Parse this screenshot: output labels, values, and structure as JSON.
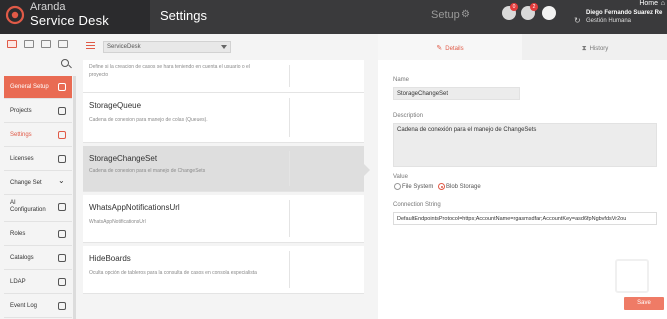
{
  "brand": {
    "line1": "Aranda",
    "line2": "Service Desk"
  },
  "page_title": "Settings",
  "setup_label": "Setup",
  "notifications": {
    "first_count": "0",
    "second_count": "2"
  },
  "home_label": "Home",
  "user": {
    "name": "Diego Fernando Suarez Re",
    "group": "Gestión Humana"
  },
  "nav": [
    {
      "label": "General Setup",
      "icon": "gears-icon"
    },
    {
      "label": "Projects",
      "icon": "gear-icon"
    },
    {
      "label": "Settings",
      "icon": "sliders-icon"
    },
    {
      "label": "Licenses",
      "icon": "shield-icon"
    },
    {
      "label": "Change Set",
      "icon": "chevron-down-icon"
    },
    {
      "label": "AI Configuration",
      "icon": "robot-icon"
    },
    {
      "label": "Roles",
      "icon": "id-card-icon"
    },
    {
      "label": "Catalogs",
      "icon": "catalog-icon"
    },
    {
      "label": "LDAP",
      "icon": "ldap-icon"
    },
    {
      "label": "Event Log",
      "icon": "event-log-icon"
    }
  ],
  "project_select": {
    "value": "ServiceDesk"
  },
  "settings": [
    {
      "title": "",
      "description": "Define si la creacion de casos se hara teniendo en cuenta el usuario o el proyecto"
    },
    {
      "title": "StorageQueue",
      "description": "Cadena de conexion para manejo de colas (Queues)."
    },
    {
      "title": "StorageChangeSet",
      "description": "Cadena de conexion para el manejo de ChangeSets"
    },
    {
      "title": "WhatsAppNotificationsUrl",
      "description": "WhatsAppNotificationsUrl"
    },
    {
      "title": "HideBoards",
      "description": "Oculta opción de tableros para la consulta de casos en consola especialista"
    }
  ],
  "tabs": {
    "details": "Details",
    "history": "History"
  },
  "form": {
    "name_label": "Name",
    "name_value": "StorageChangeSet",
    "description_label": "Description",
    "description_value": "Cadena de conexión para el manejo de ChangeSets",
    "value_label": "Value",
    "option_file": "File System",
    "option_blob": "Blob Storage",
    "connection_label": "Connection String",
    "connection_value": "DefaultEndpointsProtocol=https;AccountName=rgasmsdfar;AccountKey=asd6fpNgbvfdsVr2ou",
    "save_label": "Save"
  },
  "colors": {
    "accent": "#e05a47",
    "topbar": "#3a3a3c",
    "nav_active": "#e96b53"
  }
}
